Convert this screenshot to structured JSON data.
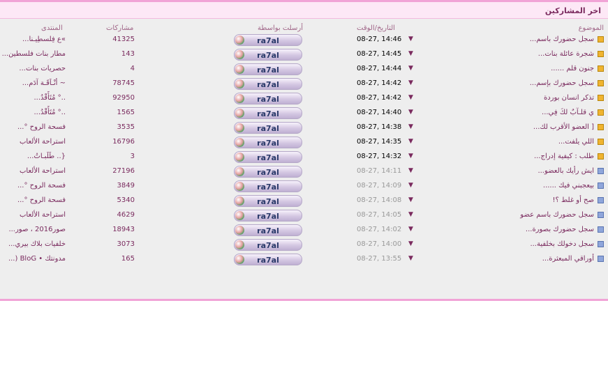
{
  "panel": {
    "title": "اخر المشاركين"
  },
  "columns": {
    "topic": "الموضوع",
    "date": "التاريخ/الوقت",
    "sender": "أرسلت بواسطة",
    "posts": "مشاركات",
    "forum": "المنتدى"
  },
  "icons": {
    "topic_new": "folder-new-icon",
    "topic_read": "folder-read-icon",
    "arrow": "down-arrow-icon",
    "avatar": "user-avatar-icon"
  },
  "colors": {
    "accent": "#f1a3d6",
    "header_bg": "#fde8f6",
    "link": "#7a2a5e"
  },
  "rows": [
    {
      "title": "سجل حضورك باسم...",
      "date": "08-27, 14:46",
      "sender": "ra7al",
      "posts": "41325",
      "forum": "»ع فِلسطِيـنا...",
      "unread": true
    },
    {
      "title": "شجرة عائلة بنات...",
      "date": "08-27, 14:45",
      "sender": "ra7al",
      "posts": "143",
      "forum": "مطار بنات فلسطين...",
      "unread": true
    },
    {
      "title": "جنون قلم ......",
      "date": "08-27, 14:44",
      "sender": "ra7al",
      "posts": "4",
      "forum": "حصريات بنات...",
      "unread": true
    },
    {
      "title": "سجل حضورك بإسم...",
      "date": "08-27, 14:42",
      "sender": "ra7al",
      "posts": "78745",
      "forum": "~ أنْـاَقَـة آدَم...",
      "unread": true
    },
    {
      "title": "تذكر انسان بوردة",
      "date": "08-27, 14:42",
      "sender": "ra7al",
      "posts": "92950",
      "forum": "..° مُتَأَقْدُ...",
      "unread": true
    },
    {
      "title": "ي قلـآبٌ لكَ فِي...",
      "date": "08-27, 14:40",
      "sender": "ra7al",
      "posts": "1565",
      "forum": "..° مُتَأَقْدُ...",
      "unread": true
    },
    {
      "title": "[ العضو الأقرب لك...",
      "date": "08-27, 14:38",
      "sender": "ra7al",
      "posts": "3535",
      "forum": "فسحة الروح °...",
      "unread": true
    },
    {
      "title": "اللي يلفت...",
      "date": "08-27, 14:35",
      "sender": "ra7al",
      "posts": "16796",
      "forum": "استراحة الألعاب",
      "unread": true
    },
    {
      "title": "طلب : كيفية إدراج...",
      "date": "08-27, 14:32",
      "sender": "ra7al",
      "posts": "3",
      "forum": "{.. طَلَبـاتُ...",
      "unread": true
    },
    {
      "title": "ايش رأيك بالعضو...",
      "date": "08-27, 14:11",
      "sender": "ra7al",
      "posts": "27196",
      "forum": "استراحة الألعاب",
      "unread": false
    },
    {
      "title": "بيعجبني فيك ......",
      "date": "08-27, 14:09",
      "sender": "ra7al",
      "posts": "3849",
      "forum": "فسحة الروح °...",
      "unread": false
    },
    {
      "title": "صح أو غلط ؟!",
      "date": "08-27, 14:08",
      "sender": "ra7al",
      "posts": "5340",
      "forum": "فسحة الروح °...",
      "unread": false
    },
    {
      "title": "سجل حضورك باسم عضو",
      "date": "08-27, 14:05",
      "sender": "ra7al",
      "posts": "4629",
      "forum": "استراحة الألعاب",
      "unread": false
    },
    {
      "title": "سجل حضورك بصورة...",
      "date": "08-27, 14:02",
      "sender": "ra7al",
      "posts": "18943",
      "forum": "صور2016 ، صور...",
      "unread": false
    },
    {
      "title": "سجل دخولك بخلفية...",
      "date": "08-27, 14:00",
      "sender": "ra7al",
      "posts": "3073",
      "forum": "خلفيات بلاك بيري...",
      "unread": false
    },
    {
      "title": "أوراقي المبعثرة...",
      "date": "08-27, 13:55",
      "sender": "ra7al",
      "posts": "165",
      "forum": "مدونتك • BloG (...",
      "unread": false
    }
  ]
}
